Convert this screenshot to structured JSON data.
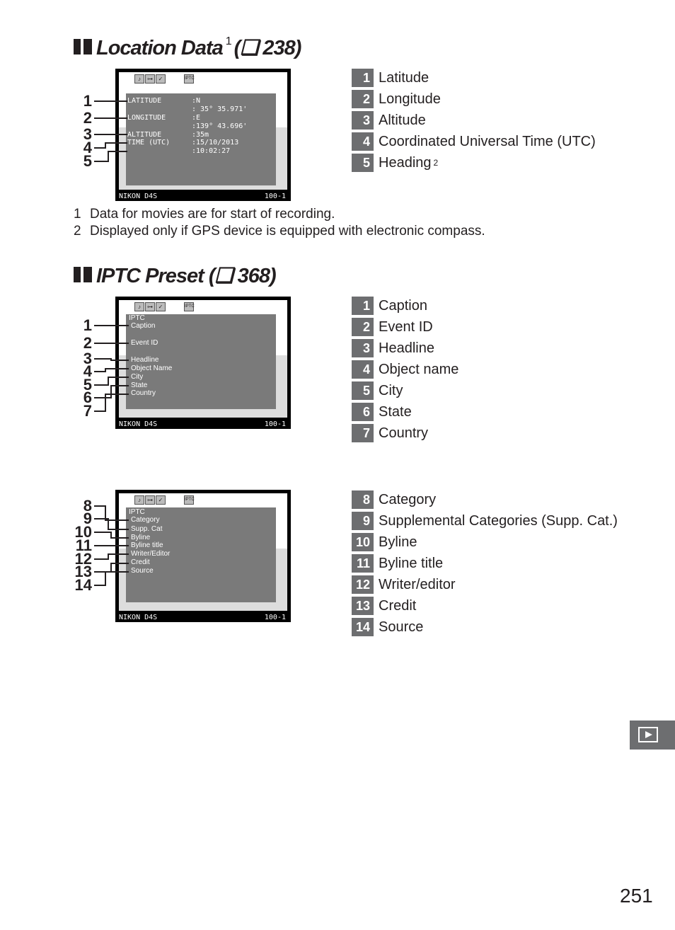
{
  "section1": {
    "title": "Location Data",
    "sup": "1",
    "ref": "(❑ 238)",
    "screen": {
      "labels": [
        "LATITUDE",
        "LONGITUDE",
        "ALTITUDE",
        "TIME (UTC)"
      ],
      "values": [
        ":N",
        ":  35°  35.971'",
        ":E",
        ":139°  43.696'",
        ":35m",
        ":15/10/2013",
        ":10:02:27"
      ],
      "camera": "NIKON D4S",
      "file": "100-1"
    },
    "items": [
      {
        "n": "1",
        "label": "Latitude"
      },
      {
        "n": "2",
        "label": "Longitude"
      },
      {
        "n": "3",
        "label": "Altitude"
      },
      {
        "n": "4",
        "label": "Coordinated Universal Time (UTC)"
      },
      {
        "n": "5",
        "label": "Heading",
        "sup": "2"
      }
    ],
    "notes": [
      {
        "n": "1",
        "text": "Data for movies are for start of recording."
      },
      {
        "n": "2",
        "text": "Displayed only if GPS device is equipped with electronic compass."
      }
    ]
  },
  "section2": {
    "title": "IPTC Preset",
    "ref": "(❑ 368)",
    "screenA": {
      "header": "IPTC",
      "labels": [
        "Caption",
        "Event  ID",
        "Headline",
        "Object  Name",
        "City",
        "State",
        "Country"
      ],
      "camera": "NIKON D4S",
      "file": "100-1"
    },
    "screenB": {
      "header": "IPTC",
      "labels": [
        "Category",
        "Supp. Cat",
        "Byline",
        "Byline title",
        "Writer/Editor",
        "Credit",
        "Source"
      ],
      "camera": "NIKON D4S",
      "file": "100-1"
    },
    "itemsA": [
      {
        "n": "1",
        "label": "Caption"
      },
      {
        "n": "2",
        "label": "Event ID"
      },
      {
        "n": "3",
        "label": "Headline"
      },
      {
        "n": "4",
        "label": "Object name"
      },
      {
        "n": "5",
        "label": "City"
      },
      {
        "n": "6",
        "label": "State"
      },
      {
        "n": "7",
        "label": "Country"
      }
    ],
    "itemsB": [
      {
        "n": "8",
        "label": "Category"
      },
      {
        "n": "9",
        "label": "Supplemental Categories (Supp. Cat.)"
      },
      {
        "n": "10",
        "label": "Byline"
      },
      {
        "n": "11",
        "label": "Byline title"
      },
      {
        "n": "12",
        "label": "Writer/editor"
      },
      {
        "n": "13",
        "label": "Credit"
      },
      {
        "n": "14",
        "label": "Source"
      }
    ]
  },
  "icons": {
    "screen": [
      "voice-memo-icon",
      "protect-icon",
      "retouch-icon",
      "iptc-icon"
    ],
    "tab": "playback-icon"
  },
  "page_number": "251"
}
